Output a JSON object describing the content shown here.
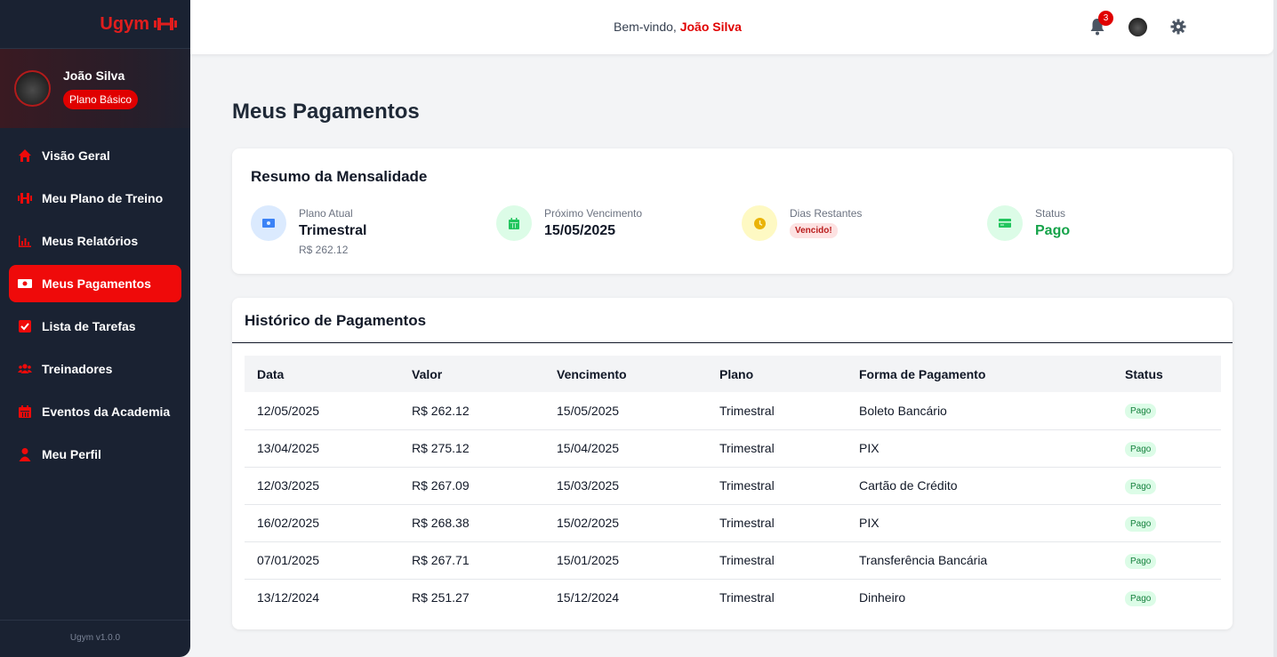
{
  "brand": {
    "name": "Ugym",
    "color": "#e11d1d"
  },
  "user": {
    "name": "João Silva",
    "plan": "Plano Básico"
  },
  "nav": [
    {
      "label": "Visão Geral",
      "icon": "home-icon",
      "active": false
    },
    {
      "label": "Meu Plano de Treino",
      "icon": "dumbbell-icon",
      "active": false
    },
    {
      "label": "Meus Relatórios",
      "icon": "bar-chart-icon",
      "active": false
    },
    {
      "label": "Meus Pagamentos",
      "icon": "money-icon",
      "active": true
    },
    {
      "label": "Lista de Tarefas",
      "icon": "checkbox-icon",
      "active": false
    },
    {
      "label": "Treinadores",
      "icon": "users-icon",
      "active": false
    },
    {
      "label": "Eventos da Academia",
      "icon": "calendar-icon",
      "active": false
    },
    {
      "label": "Meu Perfil",
      "icon": "user-icon",
      "active": false
    }
  ],
  "version": "Ugym v1.0.0",
  "header": {
    "welcome_prefix": "Bem-vindo,",
    "welcome_name": "João Silva",
    "notification_count": "3"
  },
  "page": {
    "title": "Meus Pagamentos"
  },
  "summary": {
    "title": "Resumo da Mensalidade",
    "plano_atual": {
      "label": "Plano Atual",
      "value": "Trimestral",
      "sub": "R$ 262.12"
    },
    "proximo_vencimento": {
      "label": "Próximo Vencimento",
      "value": "15/05/2025"
    },
    "dias_restantes": {
      "label": "Dias Restantes",
      "badge": "Vencido!"
    },
    "status": {
      "label": "Status",
      "value": "Pago"
    }
  },
  "history": {
    "title": "Histórico de Pagamentos",
    "columns": [
      "Data",
      "Valor",
      "Vencimento",
      "Plano",
      "Forma de Pagamento",
      "Status"
    ],
    "rows": [
      [
        "12/05/2025",
        "R$ 262.12",
        "15/05/2025",
        "Trimestral",
        "Boleto Bancário",
        "Pago"
      ],
      [
        "13/04/2025",
        "R$ 275.12",
        "15/04/2025",
        "Trimestral",
        "PIX",
        "Pago"
      ],
      [
        "12/03/2025",
        "R$ 267.09",
        "15/03/2025",
        "Trimestral",
        "Cartão de Crédito",
        "Pago"
      ],
      [
        "16/02/2025",
        "R$ 268.38",
        "15/02/2025",
        "Trimestral",
        "PIX",
        "Pago"
      ],
      [
        "07/01/2025",
        "R$ 267.71",
        "15/01/2025",
        "Trimestral",
        "Transferência Bancária",
        "Pago"
      ],
      [
        "13/12/2024",
        "R$ 251.27",
        "15/12/2024",
        "Trimestral",
        "Dinheiro",
        "Pago"
      ]
    ]
  },
  "colors": {
    "accent": "#ef0a0a",
    "sidebar_bg": "#1a2232",
    "success": "#16a34a"
  }
}
